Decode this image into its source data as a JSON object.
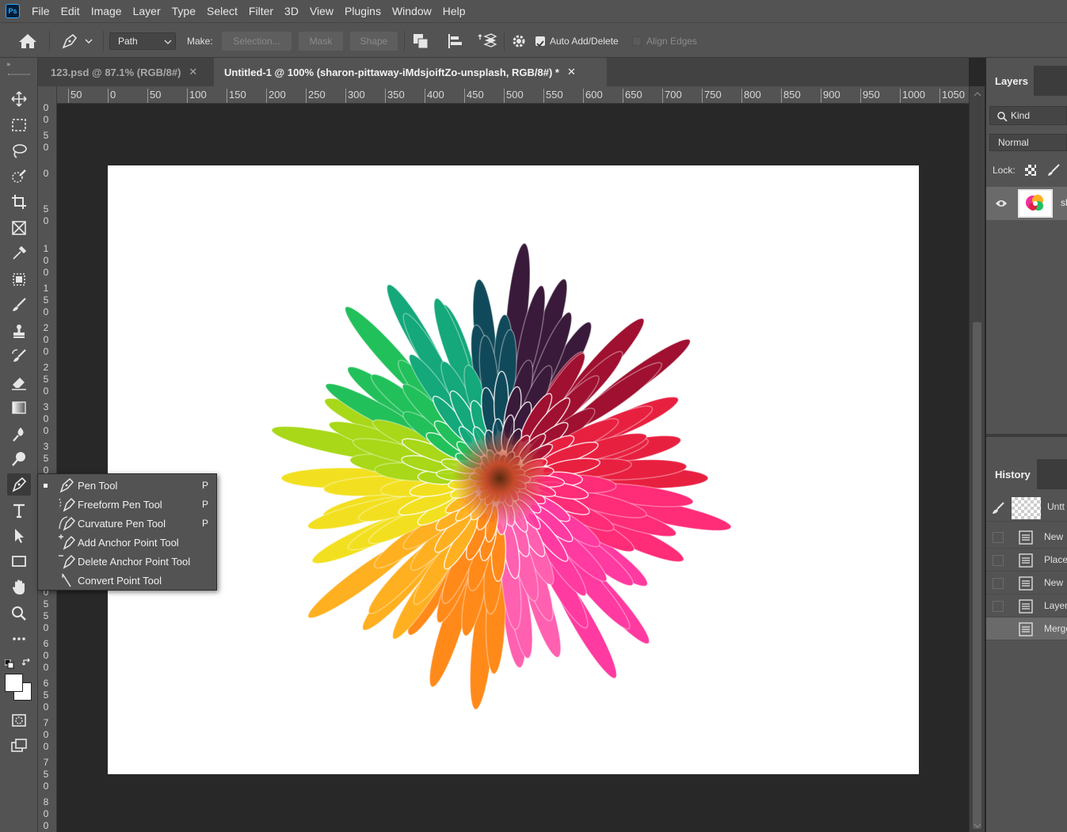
{
  "app": {
    "logo": "Ps"
  },
  "menu": [
    "File",
    "Edit",
    "Image",
    "Layer",
    "Type",
    "Select",
    "Filter",
    "3D",
    "View",
    "Plugins",
    "Window",
    "Help"
  ],
  "options": {
    "mode_select": "Path",
    "make_label": "Make:",
    "selection_btn": "Selection...",
    "mask_btn": "Mask",
    "shape_btn": "Shape",
    "auto_add_delete": "Auto Add/Delete",
    "align_edges": "Align Edges"
  },
  "tabs": [
    {
      "label": "123.psd @ 87.1% (RGB/8#)",
      "active": false
    },
    {
      "label": "Untitled-1 @ 100% (sharon-pittaway-iMdsjoiftZo-unsplash, RGB/8#) *",
      "active": true
    }
  ],
  "ruler_h": [
    "50",
    "0",
    "50",
    "100",
    "150",
    "200",
    "250",
    "300",
    "350",
    "400",
    "450",
    "500",
    "550",
    "600",
    "650",
    "700",
    "750",
    "800",
    "850",
    "900",
    "950",
    "1000",
    "1050"
  ],
  "ruler_v": [
    "0",
    "0",
    "5",
    "0",
    "0",
    "5",
    "0",
    "1",
    "0",
    "0",
    "1",
    "5",
    "0",
    "2",
    "0",
    "0",
    "2",
    "5",
    "0",
    "3",
    "0",
    "0",
    "3",
    "5",
    "0",
    "0",
    "5",
    "5",
    "0",
    "6",
    "0",
    "0",
    "6",
    "5",
    "0",
    "7",
    "0",
    "0",
    "7",
    "5",
    "0",
    "8",
    "0",
    "0"
  ],
  "flyout": [
    {
      "label": "Pen Tool",
      "key": "P",
      "icon": "pen-icon",
      "active": true
    },
    {
      "label": "Freeform Pen Tool",
      "key": "P",
      "icon": "freeform-pen-icon",
      "active": false
    },
    {
      "label": "Curvature Pen Tool",
      "key": "P",
      "icon": "curvature-pen-icon",
      "active": false
    },
    {
      "label": "Add Anchor Point Tool",
      "key": "",
      "icon": "add-anchor-icon",
      "active": false
    },
    {
      "label": "Delete Anchor Point Tool",
      "key": "",
      "icon": "delete-anchor-icon",
      "active": false
    },
    {
      "label": "Convert Point Tool",
      "key": "",
      "icon": "convert-point-icon",
      "active": false
    }
  ],
  "layers_panel": {
    "tab": "Layers",
    "kind": "Kind",
    "blend": "Normal",
    "lock_label": "Lock:",
    "layer_name_partial": "sl"
  },
  "history_panel": {
    "tab": "History",
    "snapshot": "Untt",
    "items": [
      "New",
      "Place",
      "New",
      "Layer",
      "Merge"
    ]
  }
}
